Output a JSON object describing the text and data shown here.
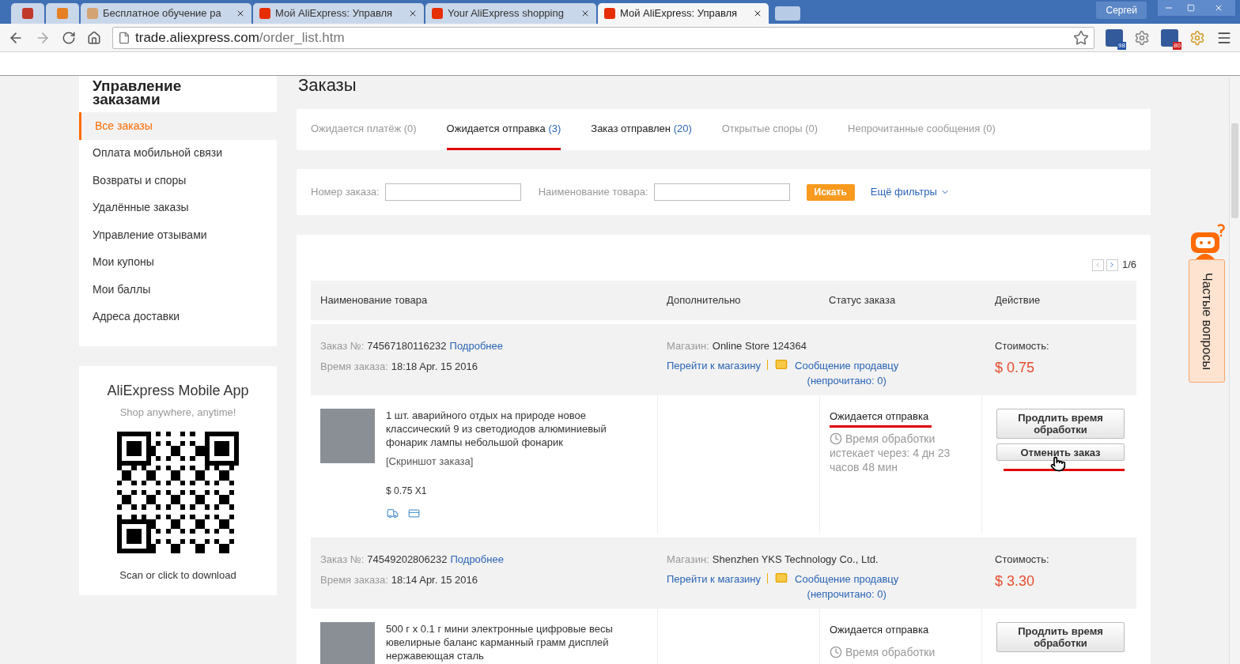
{
  "browser": {
    "tabs": [
      {
        "kind": "pinned",
        "selected": false,
        "color": "#c0392b"
      },
      {
        "kind": "pinned",
        "selected": false,
        "color": "#e67e22"
      },
      {
        "kind": "page",
        "title": "Бесплатное обучение ра",
        "selected": false,
        "color": "#d4a373"
      },
      {
        "kind": "page",
        "title": "Мой AliExpress: Управля",
        "selected": false,
        "color": "#e62e04"
      },
      {
        "kind": "page",
        "title": "Your AliExpress shopping",
        "selected": false,
        "color": "#e62e04"
      },
      {
        "kind": "page",
        "title": "Мой AliExpress: Управля",
        "selected": true,
        "color": "#e62e04"
      }
    ],
    "user": "Сергей",
    "url_host": "trade.aliexpress.com",
    "url_path": "/order_list.htm",
    "badges": [
      "98",
      "80"
    ]
  },
  "sidebar": {
    "heading": "Управление заказами",
    "items": [
      {
        "label": "Все заказы",
        "selected": true
      },
      {
        "label": "Оплата мобильной связи",
        "selected": false
      },
      {
        "label": "Возвраты и споры",
        "selected": false
      },
      {
        "label": "Удалённые заказы",
        "selected": false
      },
      {
        "label": "Управление отзывами",
        "selected": false
      },
      {
        "label": "Мои купоны",
        "selected": false
      },
      {
        "label": "Мои баллы",
        "selected": false
      },
      {
        "label": "Адреса доставки",
        "selected": false
      }
    ],
    "app": {
      "title": "AliExpress Mobile App",
      "subtitle": "Shop anywhere, anytime!",
      "caption": "Scan or click to download"
    }
  },
  "heading": "Заказы",
  "status_tabs": [
    {
      "label": "Ожидается платёж",
      "count": "(0)",
      "selected": false,
      "active": false
    },
    {
      "label": "Ожидается отправка",
      "count": "(3)",
      "selected": true,
      "active": true
    },
    {
      "label": "Заказ отправлен",
      "count": "(20)",
      "selected": false,
      "active": true
    },
    {
      "label": "Открытые споры",
      "count": "(0)",
      "selected": false,
      "active": false
    },
    {
      "label": "Непрочитанные сообщения",
      "count": "(0)",
      "selected": false,
      "active": false
    }
  ],
  "filters": {
    "order_label": "Номер заказа:",
    "product_label": "Наименование товара:",
    "search_button": "Искать",
    "more_filters": "Ещё фильтры"
  },
  "pager": "1/6",
  "columns": [
    "Наименование товара",
    "Дополнительно",
    "Статус заказа",
    "Действие"
  ],
  "orders": [
    {
      "order_no_label": "Заказ №:",
      "order_no": "74567180116232",
      "details_link": "Подробнее",
      "time_label": "Время заказа:",
      "time": "18:18 Apr. 15 2016",
      "store_label": "Магазин:",
      "store": "Online Store 124364",
      "store_link": "Перейти к магазину",
      "message_link": "Сообщение продавцу",
      "unread": "(непрочитано: 0)",
      "cost_label": "Стоимость:",
      "cost": "$ 0.75",
      "item": {
        "title": "1 шт. аварийного отдых на природе новое классический 9 из светодиодов алюминиевый фонарик лампы небольшой фонарик",
        "snapshot": "[Скриншот заказа]",
        "price_qty": "$ 0.75 X1",
        "status": "Ожидается отправка",
        "processing_title": "Время обработки",
        "processing_rest": "истекает через: 4 дн 23 часов 48 мин",
        "buttons": [
          "Продлить время обработки",
          "Отменить заказ"
        ],
        "annotated": true
      }
    },
    {
      "order_no_label": "Заказ №:",
      "order_no": "74549202806232",
      "details_link": "Подробнее",
      "time_label": "Время заказа:",
      "time": "18:14 Apr. 15 2016",
      "store_label": "Магазин:",
      "store": "Shenzhen YKS Technology Co., Ltd.",
      "store_link": "Перейти к магазину",
      "message_link": "Сообщение продавцу",
      "unread": "(непрочитано: 0)",
      "cost_label": "Стоимость:",
      "cost": "$ 3.30",
      "item": {
        "title": "500 г x 0.1 г мини электронные цифровые весы ювелирные баланс карманный грамм дисплей нержавеющая сталь",
        "status": "Ожидается отправка",
        "processing_title": "Время обработки",
        "buttons": [
          "Продлить время обработки"
        ],
        "annotated": false
      }
    }
  ],
  "help": {
    "label": "Частые вопросы"
  }
}
